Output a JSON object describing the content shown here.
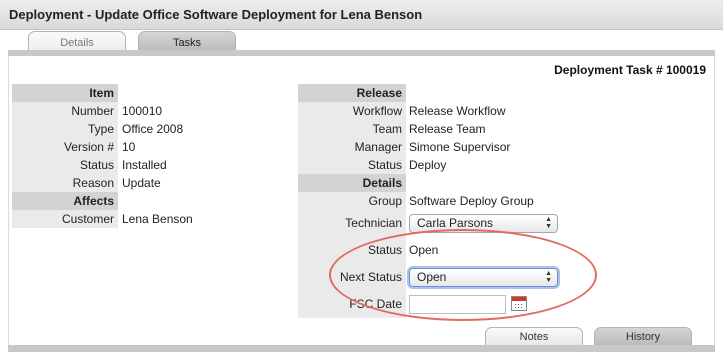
{
  "window": {
    "title": "Deployment - Update Office Software Deployment for Lena Benson"
  },
  "tabs": [
    {
      "label": "Details"
    },
    {
      "label": "Tasks"
    }
  ],
  "task_number": "Deployment Task # 100019",
  "item": {
    "header": "Item",
    "number_label": "Number",
    "number_value": "100010",
    "type_label": "Type",
    "type_value": "Office 2008",
    "version_label": "Version #",
    "version_value": "10",
    "status_label": "Status",
    "status_value": "Installed",
    "reason_label": "Reason",
    "reason_value": "Update"
  },
  "affects": {
    "header": "Affects",
    "customer_label": "Customer",
    "customer_value": "Lena Benson"
  },
  "release": {
    "header": "Release",
    "workflow_label": "Workflow",
    "workflow_value": "Release Workflow",
    "team_label": "Team",
    "team_value": "Release Team",
    "manager_label": "Manager",
    "manager_value": "Simone Supervisor",
    "status_label": "Status",
    "status_value": "Deploy"
  },
  "details": {
    "header": "Details",
    "group_label": "Group",
    "group_value": "Software Deploy Group",
    "technician_label": "Technician",
    "technician_value": "Carla Parsons",
    "status_label": "Status",
    "status_value": "Open",
    "next_status_label": "Next Status",
    "next_status_value": "Open",
    "fsc_date_label": "FSC Date",
    "fsc_date_value": ""
  },
  "bottom_tabs": [
    {
      "label": "Notes"
    },
    {
      "label": "History"
    }
  ],
  "colors": {
    "link": "#1f4fc8",
    "highlight_ellipse": "#e36a5f",
    "label_bg": "#eaeaea",
    "header_bg": "#d3d3d3"
  }
}
